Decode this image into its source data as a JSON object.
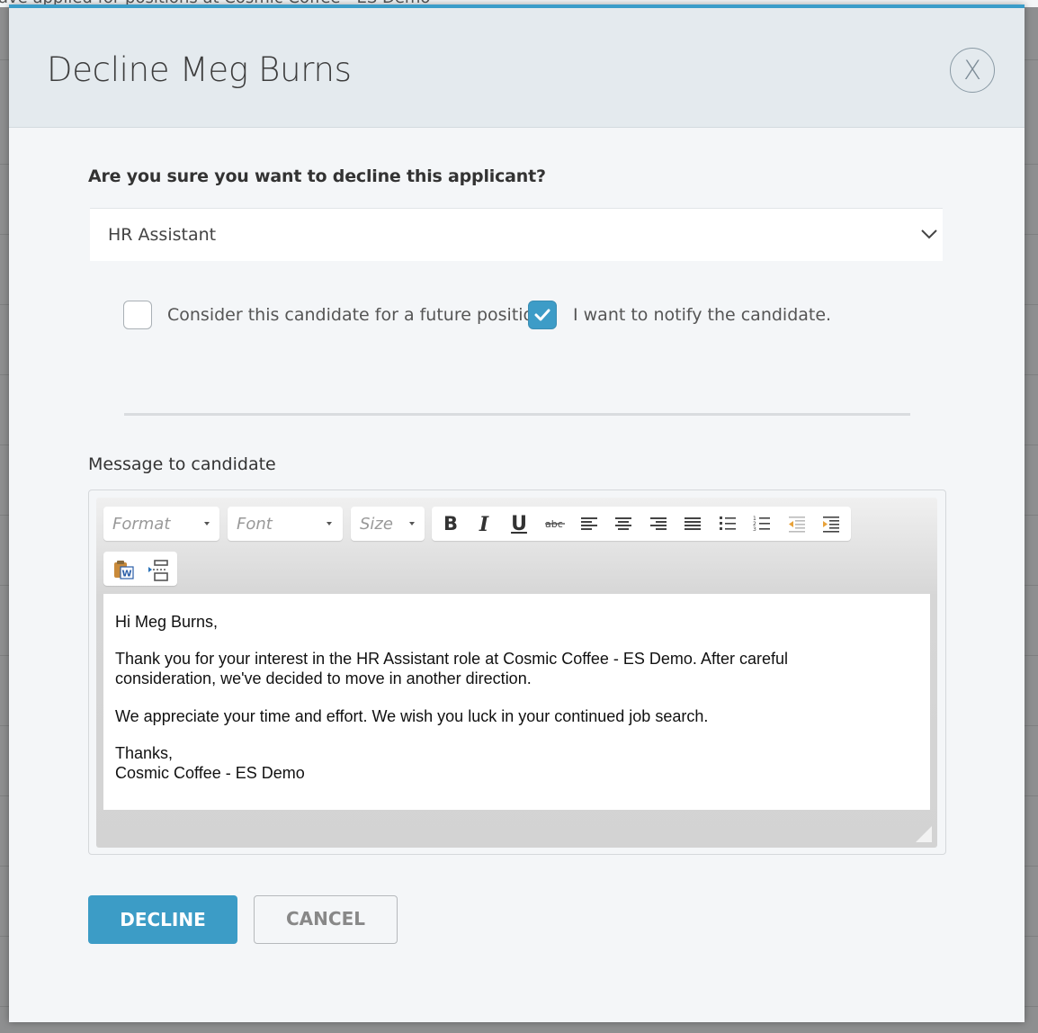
{
  "background": {
    "text": "ave applied for positions at Cosmic Coffee - ES Demo"
  },
  "modal": {
    "title": "Decline Meg Burns",
    "close_label": "X",
    "question": "Are you sure you want to decline this applicant?",
    "position_select": {
      "value": "HR Assistant"
    },
    "checkboxes": [
      {
        "label": "Consider this candidate for a future position",
        "checked": false
      },
      {
        "label": "I want to notify the candidate.",
        "checked": true
      }
    ],
    "message_label": "Message to candidate",
    "editor": {
      "format_placeholder": "Format",
      "font_placeholder": "Font",
      "size_placeholder": "Size",
      "bold_label": "B",
      "italic_label": "I",
      "underline_label": "U",
      "message": {
        "greeting": "Hi Meg Burns,",
        "para1_line1": "Thank you for your interest in the HR Assistant role at Cosmic Coffee - ES Demo. After careful",
        "para1_line2": "consideration, we've decided to move in another direction.",
        "para2": "We appreciate your time and effort. We wish you luck in your continued job search.",
        "closing": "Thanks,",
        "signature": "Cosmic Coffee - ES Demo"
      }
    },
    "decline_label": "DECLINE",
    "cancel_label": "CANCEL"
  },
  "colors": {
    "accent": "#3c9cc6",
    "header_bg": "#e4eaee",
    "modal_bg": "#f4f6f8"
  }
}
